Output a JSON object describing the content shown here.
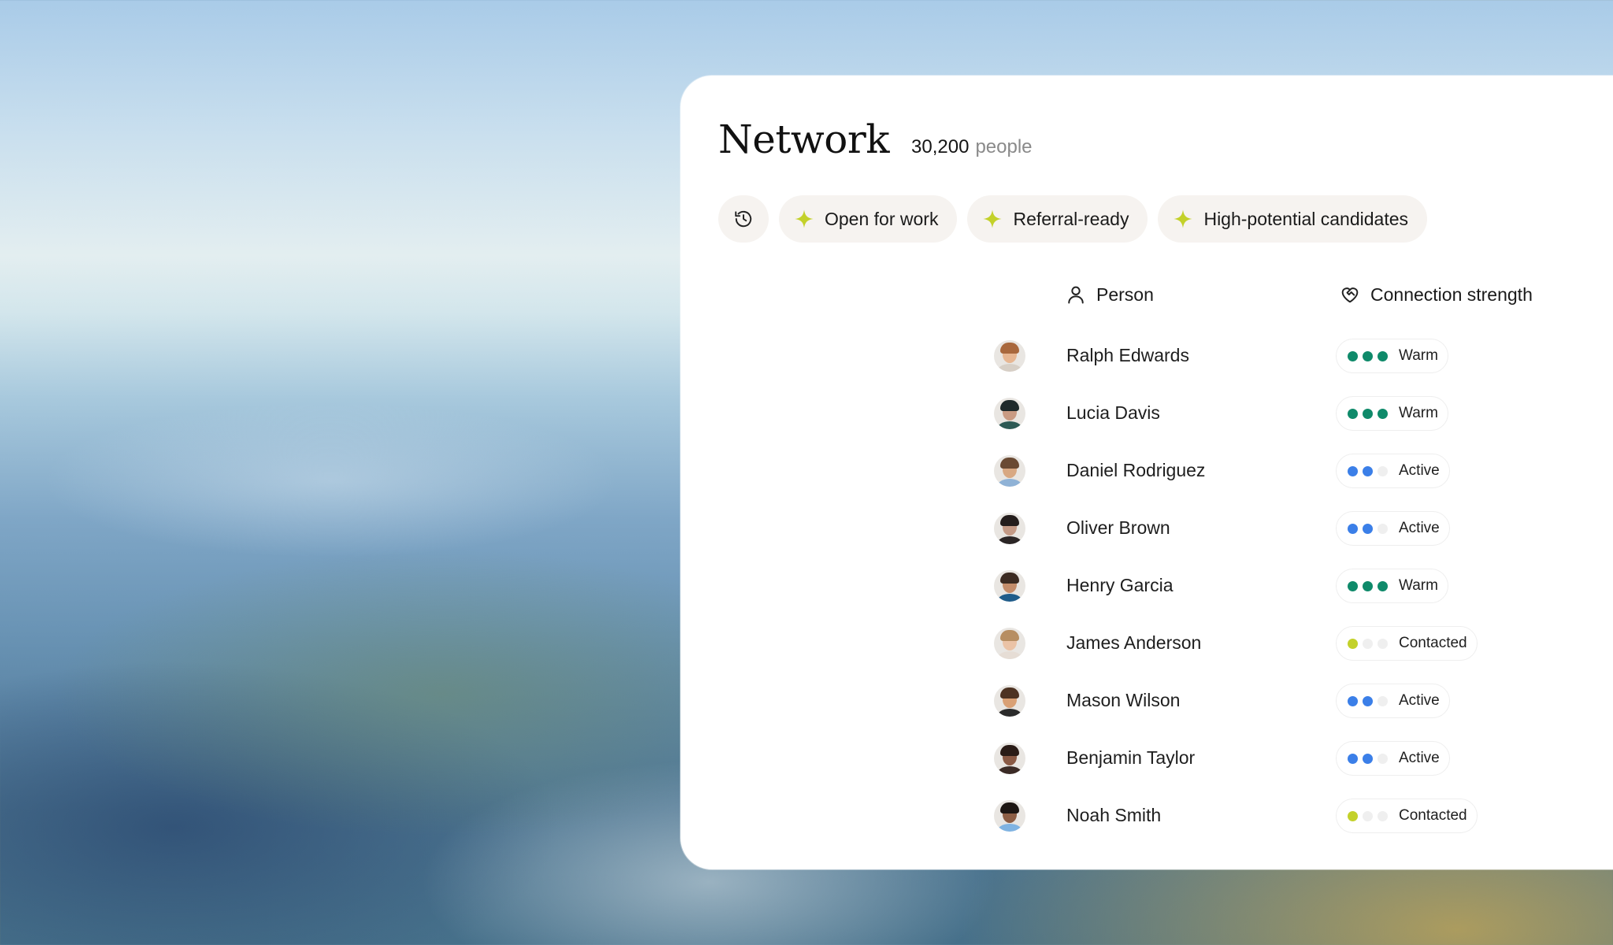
{
  "network": {
    "title": "Network",
    "count": "30,200",
    "count_unit": "people"
  },
  "filters": {
    "history_icon": "history-icon",
    "chips": [
      {
        "label": "Open for work",
        "icon": "sparkle-icon"
      },
      {
        "label": "Referral-ready",
        "icon": "sparkle-icon"
      },
      {
        "label": "High-potential candidates",
        "icon": "sparkle-icon"
      }
    ]
  },
  "table": {
    "columns": {
      "person": {
        "label": "Person",
        "icon": "person-icon"
      },
      "strength": {
        "label": "Connection strength",
        "icon": "heart-handshake-icon"
      }
    },
    "status_colors": {
      "Warm": "#0f8a6a",
      "Active": "#3b7fe8",
      "Contacted": "#c3d12a",
      "empty": "#efefef"
    },
    "rows": [
      {
        "name": "Ralph Edwards",
        "status": "Warm",
        "level": 3,
        "skin": "#e7b692",
        "hair": "#a9683d",
        "shirt": "#d7cfc6"
      },
      {
        "name": "Lucia Davis",
        "status": "Warm",
        "level": 3,
        "skin": "#c99b83",
        "hair": "#1f2a2b",
        "shirt": "#2d5a55"
      },
      {
        "name": "Daniel Rodriguez",
        "status": "Active",
        "level": 2,
        "skin": "#d8a882",
        "hair": "#6a4a33",
        "shirt": "#8fb2d6"
      },
      {
        "name": "Oliver Brown",
        "status": "Active",
        "level": 2,
        "skin": "#c49a86",
        "hair": "#241d1c",
        "shirt": "#2b2525"
      },
      {
        "name": "Henry Garcia",
        "status": "Warm",
        "level": 3,
        "skin": "#c48d6b",
        "hair": "#3c2b22",
        "shirt": "#1f5c8a"
      },
      {
        "name": "James Anderson",
        "status": "Contacted",
        "level": 1,
        "skin": "#ebc3a6",
        "hair": "#b78e62",
        "shirt": "#e6ddd5"
      },
      {
        "name": "Mason Wilson",
        "status": "Active",
        "level": 2,
        "skin": "#d9a074",
        "hair": "#4d3222",
        "shirt": "#2b2b2b"
      },
      {
        "name": "Benjamin Taylor",
        "status": "Active",
        "level": 2,
        "skin": "#8a5a45",
        "hair": "#2a1c17",
        "shirt": "#3b2b26"
      },
      {
        "name": "Noah Smith",
        "status": "Contacted",
        "level": 1,
        "skin": "#8d5e45",
        "hair": "#1d1613",
        "shirt": "#7fb3e2"
      }
    ]
  }
}
